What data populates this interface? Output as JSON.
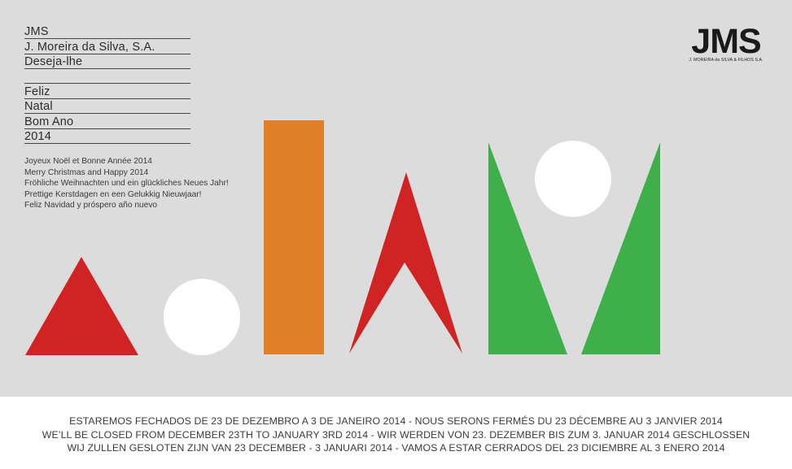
{
  "header_lines": [
    "JMS",
    "J. Moreira da Silva, S.A.",
    "Deseja-lhe",
    "",
    "Feliz",
    "Natal",
    "Bom Ano",
    "2014"
  ],
  "greetings": [
    "Joyeux Noël et Bonne Année 2014",
    "Merry Christmas and Happy 2014",
    "Fröhliche Weihnachten und ein glückliches Neues Jahr!",
    "Prettige Kerstdagen en een Gelukkig Nieuwjaar!",
    "Feliz Navidad y próspero año nuevo"
  ],
  "logo": {
    "mark": "JMS",
    "subtitle": "J. MOREIRA da SILVA & FILHOS S.A."
  },
  "closure_notice": [
    "ESTAREMOS FECHADOS DE 23 DE DEZEMBRO A 3 DE JANEIRO 2014 - NOUS SERONS FERMÉS DU 23 DÉCEMBRE AU 3 JANVIER 2014",
    "WE’LL BE CLOSED FROM DECEMBER 23TH TO JANUARY 3RD 2014 - WIR WERDEN VON 23. DEZEMBER BIS ZUM 3. JANUAR 2014 GESCHLOSSEN",
    "WIJ ZULLEN GESLOTEN ZIJN VAN 23 DECEMBER - 3 JANUARI 2014 - VAMOS A ESTAR CERRADOS DEL 23 DICIEMBRE AL 3 ENERO 2014"
  ],
  "colors": {
    "background": "#dcdcdc",
    "red": "#d02424",
    "orange": "#e07f28",
    "green": "#3faf4a",
    "white": "#ffffff"
  }
}
